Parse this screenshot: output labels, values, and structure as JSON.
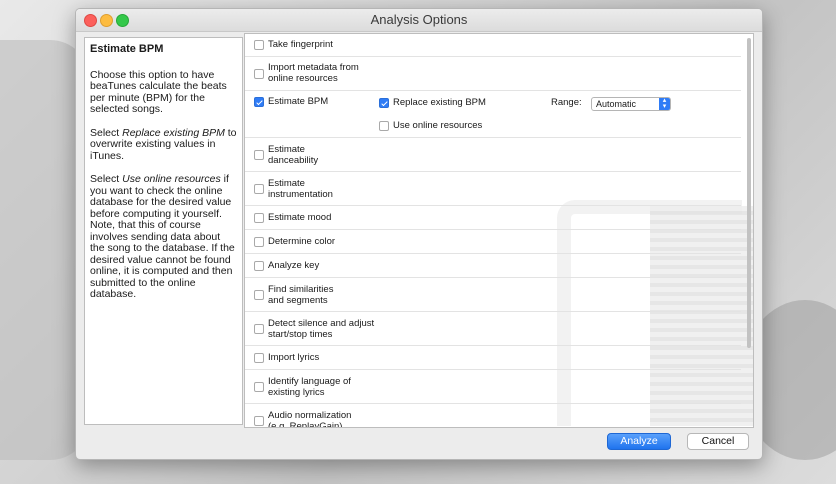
{
  "window": {
    "title": "Analysis Options"
  },
  "help": {
    "title": "Estimate BPM",
    "p1": "Choose this option to have beaTunes calculate the beats per minute (BPM) for the selected songs.",
    "p2_prefix": "Select ",
    "p2_em": "Replace existing BPM",
    "p2_suffix": " to overwrite existing values in iTunes.",
    "p3_prefix": "Select ",
    "p3_em": "Use online resources",
    "p3_suffix": " if you want to check the online database for the desired value before computing it yourself. Note, that this of course involves sending data about the song to the database. If the desired value cannot be found online, it is computed and then submitted to the online database."
  },
  "options": [
    {
      "label": "Take fingerprint",
      "checked": false
    },
    {
      "label": "Import metadata from online resources",
      "checked": false
    },
    {
      "label": "Estimate BPM",
      "checked": true
    },
    {
      "label": "Estimate danceability",
      "checked": false
    },
    {
      "label": "Estimate instrumentation",
      "checked": false
    },
    {
      "label": "Estimate mood",
      "checked": false
    },
    {
      "label": "Determine color",
      "checked": false
    },
    {
      "label": "Analyze key",
      "checked": false
    },
    {
      "label": "Find similarities and segments",
      "checked": false
    },
    {
      "label": "Detect silence and adjust start/stop times",
      "checked": false
    },
    {
      "label": "Import lyrics",
      "checked": false
    },
    {
      "label": "Identify language of existing lyrics",
      "checked": false
    },
    {
      "label": "Audio normalization (e.g. ReplayGain)",
      "checked": false
    }
  ],
  "bpm": {
    "replace_label": "Replace existing BPM",
    "replace_checked": true,
    "online_label": "Use online resources",
    "online_checked": false,
    "range_label": "Range:",
    "range_value": "Automatic"
  },
  "buttons": {
    "analyze": "Analyze",
    "cancel": "Cancel"
  },
  "colors": {
    "accent": "#2f7cf6",
    "close": "#fc605c",
    "minimize": "#fdbc40",
    "maximize": "#34c84a"
  }
}
